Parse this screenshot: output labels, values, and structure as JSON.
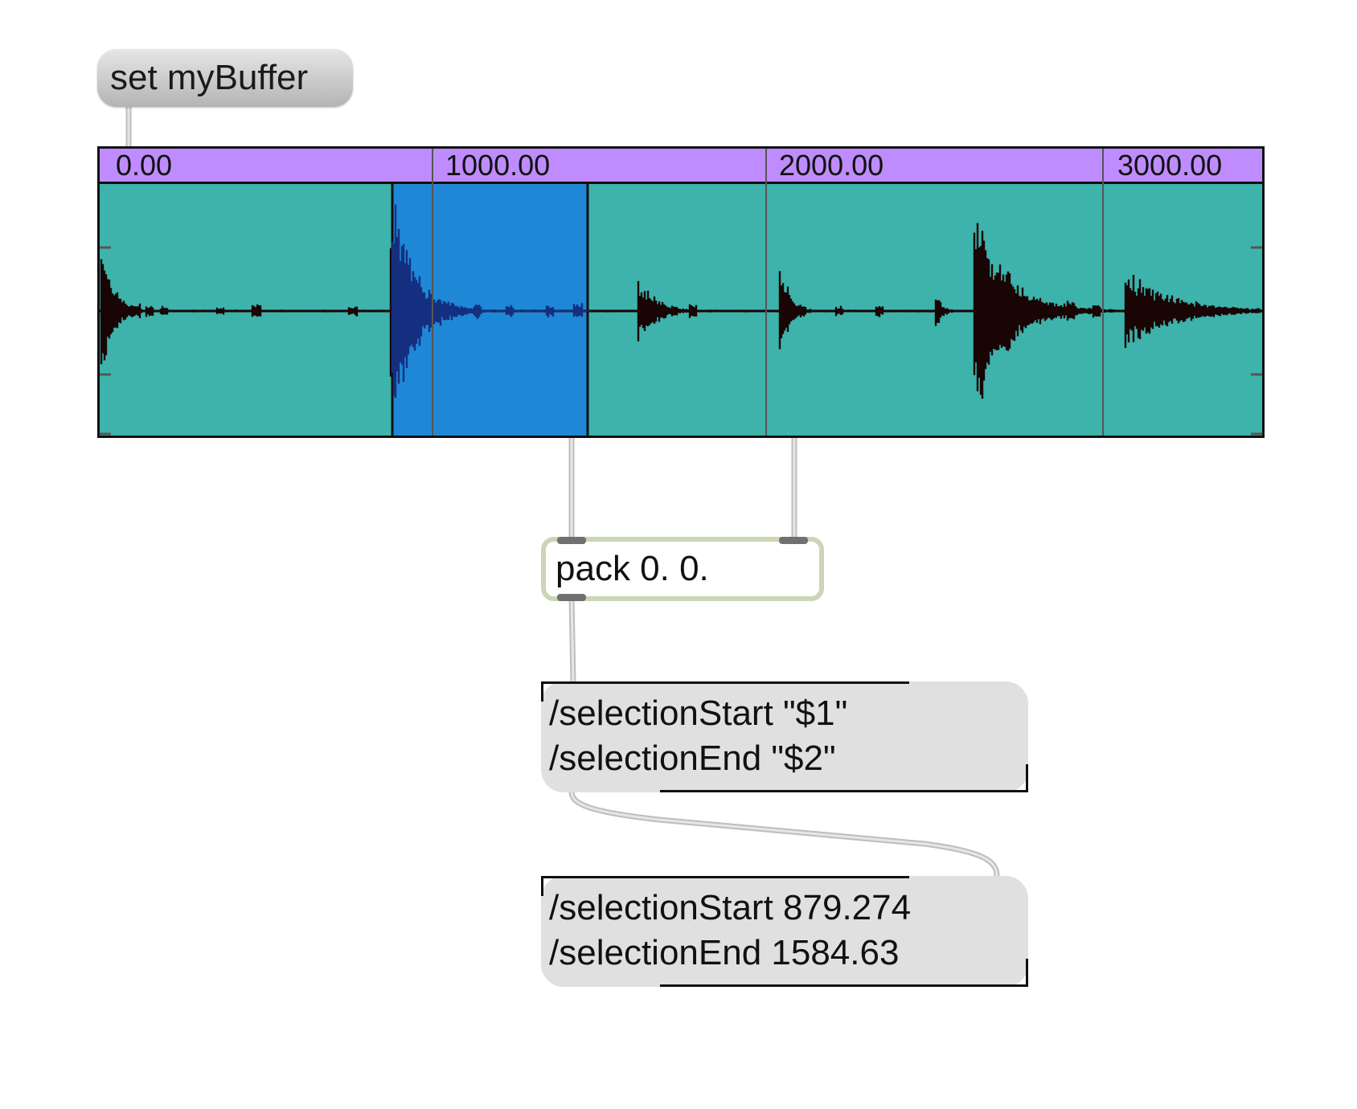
{
  "message_button": {
    "label": "set myBuffer"
  },
  "waveform": {
    "ruler_labels": [
      "0.00",
      "1000.00",
      "2000.00",
      "3000.00"
    ],
    "colors": {
      "background": "#3db3ac",
      "ruler": "#bf8cff",
      "selection": "#1f88d6",
      "waveform": "#1a0505",
      "waveform_selected": "#152f80"
    },
    "selection": {
      "start_ms": 879.274,
      "end_ms": 1584.63
    }
  },
  "pack_object": {
    "label": "pack 0. 0."
  },
  "template_message": {
    "lines": [
      "/selectionStart \"$1\"",
      "/selectionEnd \"$2\""
    ]
  },
  "output_message": {
    "lines": [
      "/selectionStart 879.274",
      "/selectionEnd 1584.63"
    ]
  }
}
